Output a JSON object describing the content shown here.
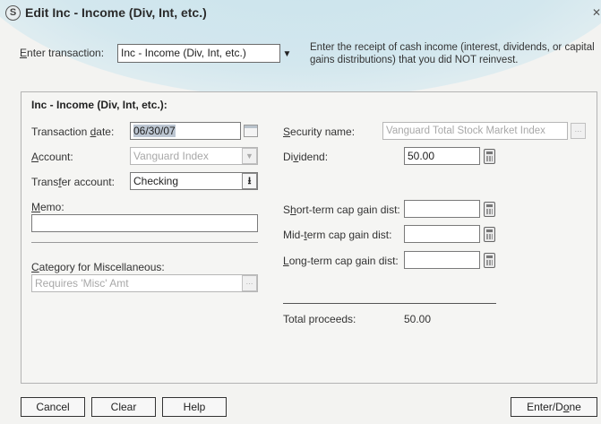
{
  "window": {
    "title": "Edit Inc - Income (Div, Int, etc.)",
    "close_glyph": "✕",
    "app_glyph": "S"
  },
  "header": {
    "enter_label_first": "E",
    "enter_label_rest": "nter transaction:",
    "transaction_type": "Inc - Income (Div, Int, etc.)",
    "description": "Enter the receipt of cash income (interest, dividends, or capital gains distributions) that you did NOT reinvest."
  },
  "panel": {
    "title": "Inc - Income (Div, Int, etc.):",
    "transaction_date": {
      "label_pre": "Transaction ",
      "label_u": "d",
      "label_post": "ate:",
      "value": "06/30/07"
    },
    "account": {
      "label_u": "A",
      "label_post": "ccount:",
      "value": "Vanguard Index"
    },
    "transfer_account": {
      "label_pre": "Trans",
      "label_u": "f",
      "label_post": "er account:",
      "value": "Checking"
    },
    "memo": {
      "label_u": "M",
      "label_post": "emo:",
      "value": ""
    },
    "category": {
      "label_u": "C",
      "label_post": "ategory for Miscellaneous:",
      "placeholder": "Requires 'Misc' Amt"
    },
    "security_name": {
      "label_u": "S",
      "label_post": "ecurity name:",
      "value": "Vanguard Total Stock Market Index"
    },
    "dividend": {
      "label_pre": "Di",
      "label_u": "v",
      "label_post": "idend:",
      "value": "50.00"
    },
    "short_term": {
      "label_pre": "S",
      "label_u": "h",
      "label_post": "ort-term cap gain dist:",
      "value": ""
    },
    "mid_term": {
      "label_pre": "Mid-",
      "label_u": "t",
      "label_post": "erm cap gain dist:",
      "value": ""
    },
    "long_term": {
      "label_u": "L",
      "label_post": "ong-term cap gain dist:",
      "value": ""
    },
    "total_proceeds": {
      "label": "Total proceeds:",
      "value": "50.00"
    }
  },
  "footer": {
    "cancel": "Cancel",
    "clear": "Clear",
    "help": "Help",
    "enter_done_pre": "Enter/D",
    "enter_done_u": "o",
    "enter_done_post": "ne"
  }
}
